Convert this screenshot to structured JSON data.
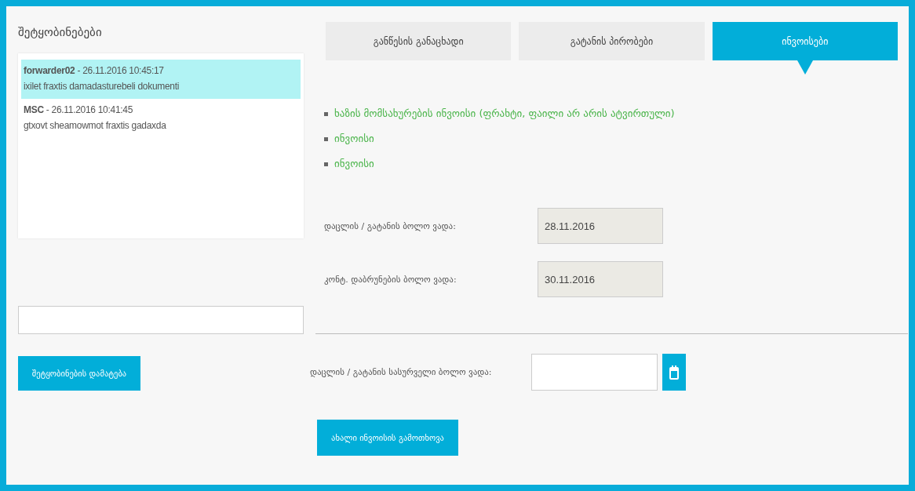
{
  "messages_panel": {
    "title": "შეტყობინებები",
    "messages": [
      {
        "sender": "forwarder02",
        "time": "- 26.11.2016 10:45:17",
        "text": "ixilet fraxtis damadasturebeli dokumenti",
        "selected": true
      },
      {
        "sender": "MSC",
        "time": "- 26.11.2016 10:41:45",
        "text": "gtxovt sheamowmot fraxtis gadaxda",
        "selected": false
      }
    ],
    "add_button": "შეტყობინების დამატება"
  },
  "tabs": [
    {
      "label": "განწესის განაცხადი",
      "selected": false
    },
    {
      "label": "გატანის პირობები",
      "selected": false
    },
    {
      "label": "ინვოისები",
      "selected": true
    }
  ],
  "invoice_links": [
    "ხაზის მომსახურების ინვოისი (ფრახტი, ფაილი არ არის ატვირთული)",
    "ინვოისი",
    "ინვოისი"
  ],
  "deadlines": [
    {
      "label": "დაცლის / გატანის ბოლო ვადა:",
      "value": "28.11.2016"
    },
    {
      "label": "კონტ. დაბრუნების ბოლო ვადა:",
      "value": "30.11.2016"
    }
  ],
  "desired_deadline": {
    "label": "დაცლის / გატანის სასურველი ბოლო ვადა:"
  },
  "request_button": "ახალი ინვოისის გამოთხოვა"
}
